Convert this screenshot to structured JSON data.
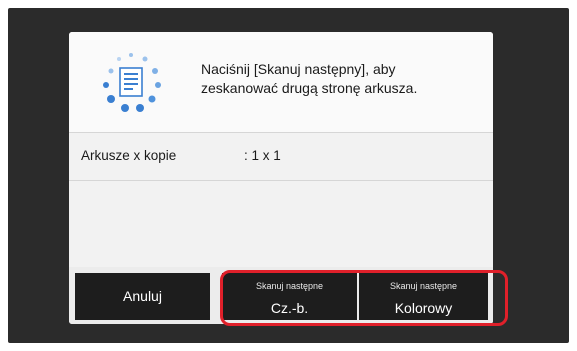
{
  "dialog": {
    "message_line1": "Naciśnij [Skanuj następny], aby",
    "message_line2": "zeskanować drugą stronę arkusza.",
    "icon": "scan-next-page-icon"
  },
  "settings": {
    "label": "Arkusze x kopie",
    "value": ": 1 x 1"
  },
  "buttons": {
    "cancel": "Anuluj",
    "scan_bw_top": "Skanuj następne",
    "scan_bw_bottom": "Cz.-b.",
    "scan_color_top": "Skanuj następne",
    "scan_color_bottom": "Kolorowy"
  },
  "colors": {
    "background": "#2b2b2b",
    "dialog": "#f2f2f2",
    "button": "#1d1d1d",
    "highlight": "#e0202a",
    "icon_accent": "#3a7fd1"
  }
}
